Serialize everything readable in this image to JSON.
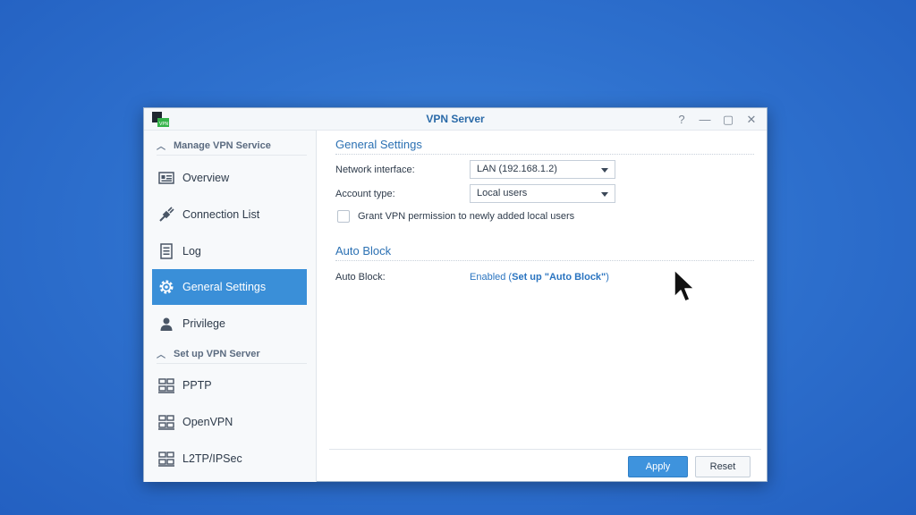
{
  "window": {
    "title": "VPN Server",
    "controls": {
      "help": "?",
      "minimize": "—",
      "maximize": "▢",
      "close": "✕"
    }
  },
  "sidebar": {
    "section_manage": "Manage VPN Service",
    "section_setup": "Set up VPN Server",
    "items": [
      {
        "label": "Overview",
        "icon": "overview-icon"
      },
      {
        "label": "Connection List",
        "icon": "connection-icon"
      },
      {
        "label": "Log",
        "icon": "log-icon"
      },
      {
        "label": "General Settings",
        "icon": "gear-icon",
        "active": true
      },
      {
        "label": "Privilege",
        "icon": "user-icon"
      },
      {
        "label": "PPTP",
        "icon": "network-icon"
      },
      {
        "label": "OpenVPN",
        "icon": "network-icon"
      },
      {
        "label": "L2TP/IPSec",
        "icon": "network-icon"
      }
    ]
  },
  "general_settings": {
    "title": "General Settings",
    "network_interface_label": "Network interface:",
    "network_interface_value": "LAN (192.168.1.2)",
    "account_type_label": "Account type:",
    "account_type_value": "Local users",
    "grant_permission_label": "Grant VPN permission to newly added local users",
    "grant_permission_checked": false
  },
  "auto_block": {
    "title": "Auto Block",
    "label": "Auto Block:",
    "status": "Enabled",
    "open_paren": " (",
    "link": "Set up \"Auto Block\"",
    "close_paren": ")"
  },
  "footer": {
    "apply": "Apply",
    "reset": "Reset"
  },
  "colors": {
    "accent": "#3a8fd8",
    "title": "#2a6aa8",
    "link": "#2a74c0",
    "desktop": "#2f72cf"
  }
}
